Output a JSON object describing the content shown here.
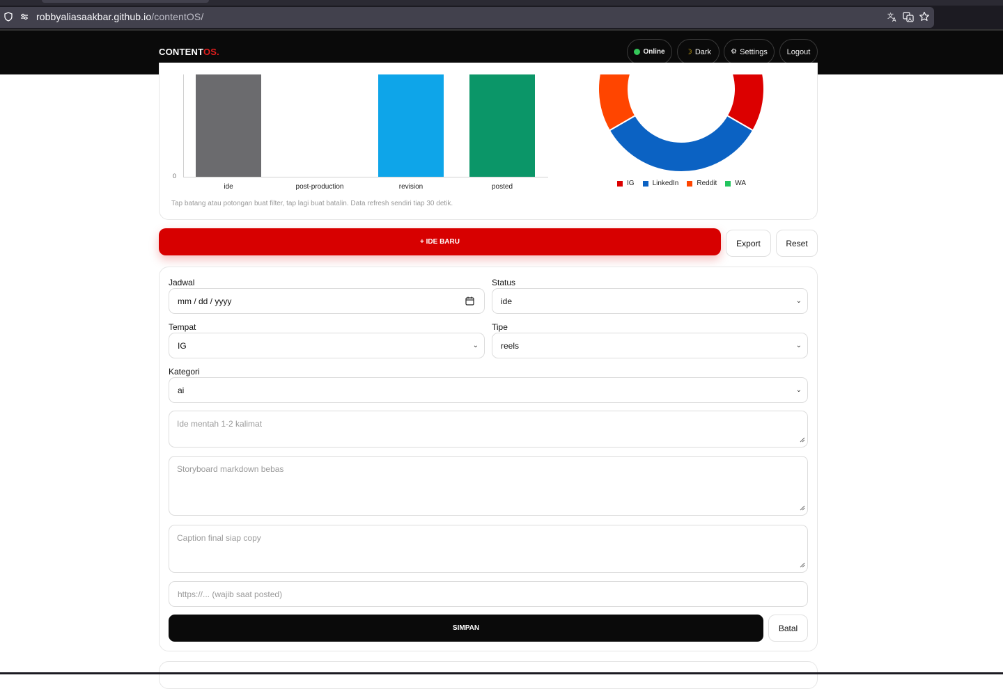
{
  "browser": {
    "url_host": "robbyaliasaakbar.github.io",
    "url_path": "/contentOS/",
    "icons": [
      "shield-icon",
      "site-settings-icon",
      "translate-icon",
      "page-translate-icon",
      "bookmark-star-icon"
    ]
  },
  "header": {
    "brand_main": "CONTENT",
    "brand_accent": "OS.",
    "online_label": "Online",
    "dark_label": "Dark",
    "settings_label": "Settings",
    "logout_label": "Logout"
  },
  "colors": {
    "accent": "#d70000",
    "ide": "#6b6b6e",
    "revision": "#0ea5e9",
    "posted": "#0b9668",
    "ig": "#dc0000",
    "linkedin": "#0b62c3",
    "reddit": "#ff4500",
    "wa": "#22c55e"
  },
  "chart_data": [
    {
      "type": "bar",
      "categories": [
        "ide",
        "post-production",
        "revision",
        "posted"
      ],
      "y_tick_labels": [
        "0"
      ],
      "ylim_note": "top of chart scrolled out of view; only baseline tick visible",
      "values_relative": [
        1.0,
        0.0,
        1.0,
        1.0
      ]
    },
    {
      "type": "pie",
      "subtype": "donut",
      "labels": [
        "IG",
        "LinkedIn",
        "Reddit",
        "WA"
      ],
      "values": [
        2,
        1,
        1,
        0
      ],
      "note": "upper half scrolled out of view; visible arcs: IG red (right), LinkedIn blue (bottom), Reddit orange (left)"
    }
  ],
  "chart_note": "Tap batang atau potongan buat filter, tap lagi buat batalin. Data refresh sendiri tiap 30 detik.",
  "actions": {
    "new_idea_label": "+ IDE BARU",
    "export_label": "Export",
    "reset_label": "Reset"
  },
  "form": {
    "jadwal_label": "Jadwal",
    "jadwal_value": "mm / dd / yyyy",
    "status_label": "Status",
    "status_value": "ide",
    "tempat_label": "Tempat",
    "tempat_value": "IG",
    "tipe_label": "Tipe",
    "tipe_value": "reels",
    "kategori_label": "Kategori",
    "kategori_value": "ai",
    "ide_placeholder": "Ide mentah 1-2 kalimat",
    "storyboard_placeholder": "Storyboard markdown bebas",
    "caption_placeholder": "Caption final siap copy",
    "link_placeholder": "https://... (wajib saat posted)",
    "save_label": "SIMPAN",
    "cancel_label": "Batal"
  }
}
